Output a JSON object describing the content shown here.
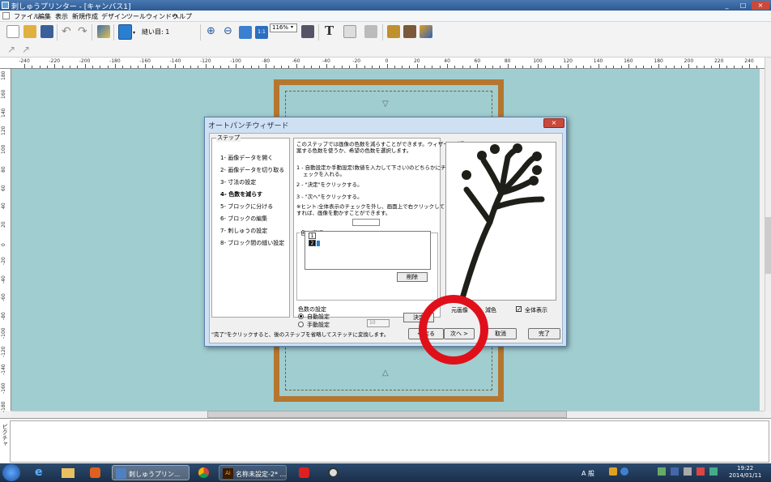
{
  "window": {
    "title": "刺しゅうプリンター - [キャンバス1]",
    "min": "_",
    "max": "□",
    "close": "×"
  },
  "menu": [
    "ファイル",
    "編集",
    "表示",
    "新規作成",
    "デザイン",
    "ツール",
    "ウィンドウ",
    "ヘルプ"
  ],
  "toolbar": {
    "stitch_label": "縫い目: 1",
    "zoom_value": "116%"
  },
  "ruler": {
    "h_labels": [
      "-240",
      "-220",
      "-200",
      "-180",
      "-160",
      "-140",
      "-120",
      "-100",
      "-80",
      "-60",
      "-40",
      "-20",
      "0",
      "20",
      "40",
      "60",
      "80",
      "100",
      "120",
      "140",
      "160",
      "180",
      "200",
      "220",
      "240"
    ],
    "v_labels": [
      "180",
      "160",
      "140",
      "120",
      "100",
      "80",
      "60",
      "40",
      "20",
      "0",
      "-20",
      "-40",
      "-60",
      "-80",
      "-100",
      "-120",
      "-140",
      "-160",
      "-180"
    ]
  },
  "bottom_panel": {
    "label": "ピクチャ"
  },
  "dialog": {
    "title": "オートパンチウィザード",
    "close": "×",
    "steps_legend": "ステップ",
    "steps": [
      "1- 画像データを開く",
      "2- 画像データを切り取る",
      "3- 寸法の設定",
      "4- 色数を減らす",
      "5- ブロックに分ける",
      "6- ブロックの編集",
      "7- 刺しゅうの設定",
      "8- ブロック間の縫い設定"
    ],
    "current_step_index": 3,
    "instructions": [
      "このステップでは画像の色数を減らすことができます。ウィザードが提",
      "案する色数を使うか、希望の色数を選択します。",
      "1 - 自動設定か手動設定(数値を入力して下さい)のどちらかにチ",
      "ェックを入れる。",
      "2 - \"決定\"をクリックする。",
      "3 - \"次へ\"をクリックする。",
      "※ヒント:全体表示のチェックを外し、画面上で右クリックしてドラッグ",
      "すれば、画像を動かすことができます。"
    ],
    "color_select_legend": "色の選択:",
    "color_list": [
      "1",
      "2"
    ],
    "delete_btn": "削除",
    "count_legend": "色数の設定",
    "auto_label": "自動設定",
    "manual_label": "手動設定",
    "manual_value": "10",
    "decide_btn": "決定",
    "original_label": "元画像",
    "reduced_label": "減色",
    "full_view_label": "全体表示",
    "footer": "\"完了\"をクリックすると、後のステップを省略してステッチに変換します。",
    "back_btn": "< 戻る",
    "next_btn": "次へ >",
    "cancel_btn": "取消",
    "finish_btn": "完了"
  },
  "taskbar": {
    "tasks": [
      "刺しゅうプリン...",
      "名称未設定-2* ..."
    ],
    "ime": "A 般",
    "time": "19:22",
    "date": "2014/01/11"
  },
  "colors": {
    "canvas": "#a0cdd0",
    "frame": "#b5762f",
    "highlight": "#e0101a"
  }
}
